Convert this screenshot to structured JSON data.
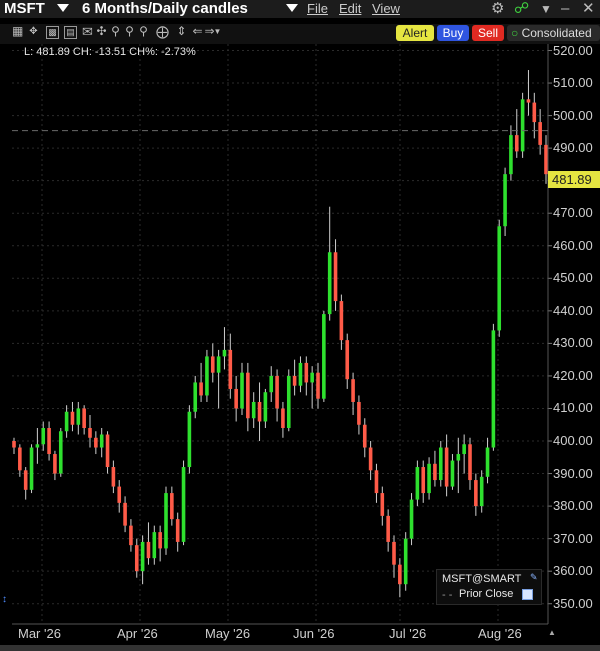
{
  "window": {
    "symbol": "MSFT",
    "period": "6 Months/Daily candles",
    "menus": [
      "File",
      "Edit",
      "View"
    ]
  },
  "toolbar": {
    "icons": [
      "chart-type-icon",
      "zoom-icon",
      "indicator-icon",
      "data-icon",
      "template-icon",
      "crosshair-icon",
      "magnifier-icon",
      "magnifier-minus-icon",
      "magnifier-plus-icon",
      "target-icon",
      "fit-icon",
      "scroll-left-icon",
      "scroll-right-icon",
      "lines-icon"
    ]
  },
  "actions": {
    "alert": "Alert",
    "buy": "Buy",
    "sell": "Sell",
    "consolidated": "Consolidated"
  },
  "colors": {
    "up": "#2ee02e",
    "down": "#ff5b48",
    "alert_bg": "#e5e541",
    "buy_bg": "#2f55e0",
    "sell_bg": "#e02a22",
    "last_price_bg": "#e5e541"
  },
  "info": "L: 481.89 CH: -13.51 CH%: -2.73%",
  "last_price_label": "481.89",
  "legend": {
    "title": "MSFT@SMART",
    "prior_close": "Prior Close"
  },
  "chart_data": {
    "type": "candlestick",
    "y_ticks": [
      "520.00",
      "510.00",
      "500.00",
      "490.00",
      "480.00",
      "470.00",
      "460.00",
      "450.00",
      "440.00",
      "430.00",
      "420.00",
      "410.00",
      "400.00",
      "390.00",
      "380.00",
      "370.00",
      "360.00",
      "350.00"
    ],
    "x_ticks": [
      "Mar '26",
      "Apr '26",
      "May '26",
      "Jun '26",
      "Jul '26",
      "Aug '26"
    ],
    "ylim": [
      345,
      522
    ],
    "prior_close": 495.4,
    "last": 481.89,
    "grid": true,
    "ohlc": [
      [
        400,
        401,
        396,
        398
      ],
      [
        398,
        399,
        389,
        391
      ],
      [
        391,
        392,
        382,
        385
      ],
      [
        385,
        399,
        384,
        398
      ],
      [
        398,
        404,
        393,
        399
      ],
      [
        399,
        406,
        397,
        404
      ],
      [
        404,
        406,
        394,
        396
      ],
      [
        396,
        397,
        388,
        390
      ],
      [
        390,
        404,
        389,
        403
      ],
      [
        403,
        411,
        401,
        409
      ],
      [
        409,
        412,
        403,
        405
      ],
      [
        405,
        412,
        402,
        410
      ],
      [
        410,
        411,
        402,
        404
      ],
      [
        404,
        408,
        398,
        401
      ],
      [
        401,
        403,
        396,
        398
      ],
      [
        398,
        404,
        395,
        402
      ],
      [
        402,
        403,
        390,
        392
      ],
      [
        392,
        394,
        384,
        386
      ],
      [
        386,
        388,
        378,
        381
      ],
      [
        381,
        383,
        372,
        374
      ],
      [
        374,
        376,
        366,
        368
      ],
      [
        368,
        370,
        358,
        360
      ],
      [
        360,
        371,
        356,
        369
      ],
      [
        369,
        375,
        362,
        364
      ],
      [
        364,
        374,
        362,
        372
      ],
      [
        372,
        374,
        363,
        367
      ],
      [
        367,
        386,
        365,
        384
      ],
      [
        384,
        386,
        374,
        376
      ],
      [
        376,
        378,
        366,
        369
      ],
      [
        369,
        394,
        368,
        392
      ],
      [
        392,
        411,
        390,
        409
      ],
      [
        409,
        420,
        407,
        418
      ],
      [
        418,
        424,
        412,
        414
      ],
      [
        414,
        428,
        412,
        426
      ],
      [
        426,
        430,
        418,
        421
      ],
      [
        421,
        428,
        410,
        426
      ],
      [
        426,
        435,
        422,
        428
      ],
      [
        428,
        433,
        413,
        416
      ],
      [
        416,
        420,
        406,
        410
      ],
      [
        410,
        424,
        408,
        421
      ],
      [
        421,
        424,
        403,
        407
      ],
      [
        407,
        415,
        404,
        412
      ],
      [
        412,
        418,
        400,
        406
      ],
      [
        406,
        416,
        404,
        415
      ],
      [
        415,
        423,
        412,
        420
      ],
      [
        420,
        422,
        406,
        410
      ],
      [
        410,
        412,
        401,
        404
      ],
      [
        404,
        422,
        403,
        420
      ],
      [
        420,
        425,
        414,
        417
      ],
      [
        417,
        426,
        415,
        424
      ],
      [
        424,
        426,
        414,
        418
      ],
      [
        418,
        423,
        410,
        421
      ],
      [
        421,
        424,
        410,
        413
      ],
      [
        413,
        440,
        412,
        439
      ],
      [
        439,
        472,
        437,
        458
      ],
      [
        458,
        462,
        440,
        443
      ],
      [
        443,
        445,
        428,
        431
      ],
      [
        431,
        433,
        416,
        419
      ],
      [
        419,
        421,
        408,
        412
      ],
      [
        412,
        414,
        402,
        405
      ],
      [
        405,
        407,
        395,
        398
      ],
      [
        398,
        400,
        388,
        391
      ],
      [
        391,
        393,
        381,
        384
      ],
      [
        384,
        386,
        374,
        377
      ],
      [
        377,
        379,
        366,
        369
      ],
      [
        369,
        371,
        358,
        362
      ],
      [
        362,
        364,
        352,
        356
      ],
      [
        356,
        372,
        354,
        370
      ],
      [
        370,
        384,
        368,
        382
      ],
      [
        382,
        394,
        380,
        392
      ],
      [
        392,
        394,
        381,
        384
      ],
      [
        384,
        395,
        382,
        393
      ],
      [
        393,
        397,
        386,
        388
      ],
      [
        388,
        400,
        386,
        398
      ],
      [
        398,
        402,
        383,
        386
      ],
      [
        386,
        396,
        385,
        394
      ],
      [
        394,
        401,
        384,
        396
      ],
      [
        396,
        402,
        390,
        399
      ],
      [
        399,
        401,
        385,
        388
      ],
      [
        388,
        390,
        377,
        380
      ],
      [
        380,
        391,
        378,
        389
      ],
      [
        389,
        401,
        387,
        398
      ],
      [
        398,
        436,
        397,
        434
      ],
      [
        434,
        468,
        432,
        466
      ],
      [
        466,
        484,
        463,
        482
      ],
      [
        482,
        497,
        480,
        494
      ],
      [
        494,
        502,
        487,
        489
      ],
      [
        489,
        507,
        487,
        505
      ],
      [
        505,
        514,
        500,
        504
      ],
      [
        504,
        507,
        493,
        498
      ],
      [
        498,
        502,
        488,
        491
      ],
      [
        491,
        494,
        479,
        482
      ]
    ]
  }
}
